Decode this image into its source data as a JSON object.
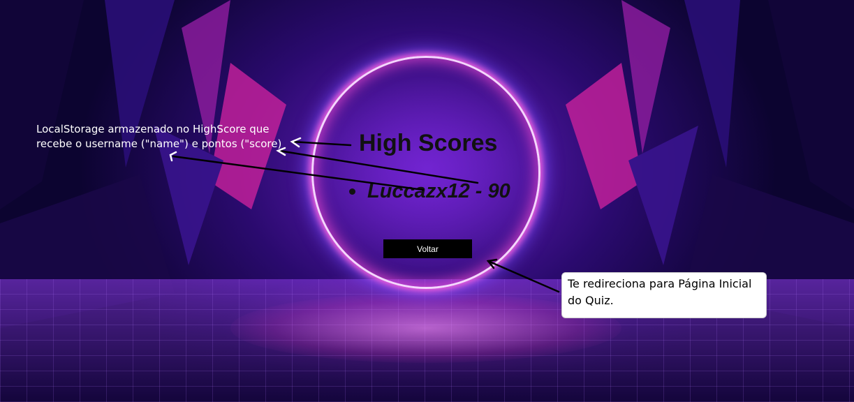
{
  "page": {
    "title": "High Scores",
    "scores": [
      {
        "entry": "Luccazx12 - 90"
      }
    ],
    "back_button_label": "Voltar"
  },
  "annotations": {
    "left_note": "LocalStorage armazenado no HighScore que recebe o username (\"name\") e pontos (\"score)",
    "right_note": "Te redireciona para Página Inicial do Quiz."
  },
  "colors": {
    "ring": "#f6d6ff",
    "ring_glow": "#ff5fd6",
    "button_bg": "#000000",
    "button_text": "#ffffff",
    "title_text": "#111111"
  }
}
